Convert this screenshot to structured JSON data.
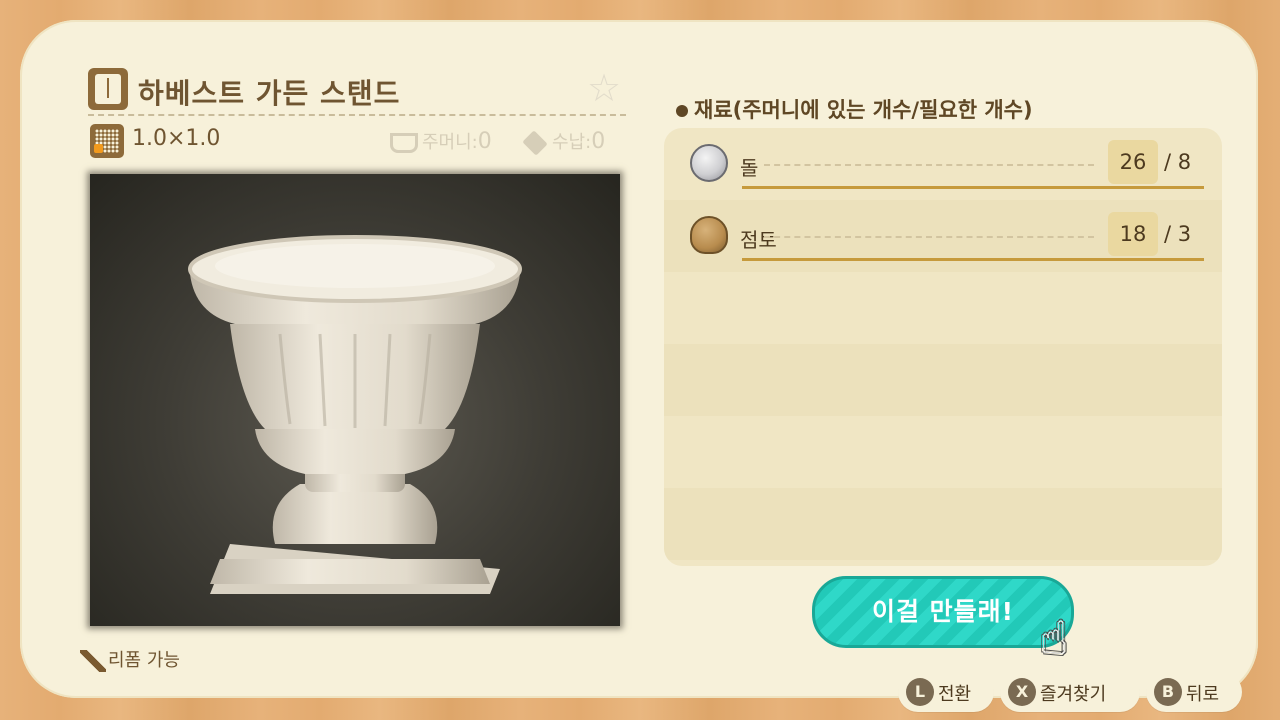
{
  "item": {
    "title": "하베스트 가든 스탠드",
    "size": "1.0×1.0",
    "pocket_label": "주머니:",
    "pocket_value": "0",
    "storage_label": "수납:",
    "storage_value": "0",
    "remake": "리폼 가능"
  },
  "materials": {
    "header": "재료(주머니에 있는 개수/필요한 개수)",
    "rows": [
      {
        "name": "돌",
        "have": "26",
        "need": "/ 8",
        "icon": "stone-icon"
      },
      {
        "name": "점토",
        "have": "18",
        "need": "/ 3",
        "icon": "clay-icon"
      }
    ]
  },
  "craft_button": "이걸 만들래!",
  "hints": [
    {
      "key": "L",
      "label": "전환"
    },
    {
      "key": "X",
      "label": "즐겨찾기"
    },
    {
      "key": "B",
      "label": "뒤로"
    }
  ],
  "colors": {
    "panel": "#f7f1da",
    "text": "#6f5531",
    "button": "#2fd8c8",
    "underline": "#c69a3c"
  }
}
